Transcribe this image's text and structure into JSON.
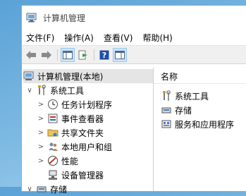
{
  "window": {
    "title": "计算机管理"
  },
  "menubar": {
    "items": [
      "文件(F)",
      "操作(A)",
      "查看(V)",
      "帮助(H)"
    ]
  },
  "tree": {
    "root": "计算机管理(本地)",
    "system_tools": "系统工具",
    "children": [
      "任务计划程序",
      "事件查看器",
      "共享文件夹",
      "本地用户和组",
      "性能",
      "设备管理器"
    ],
    "storage": "存储"
  },
  "right_pane": {
    "column_header": "名称",
    "items": [
      "系统工具",
      "存储",
      "服务和应用程序"
    ]
  },
  "colors": {
    "selection": "#e5e5e5",
    "toolbar_bg": "#f0f0f0",
    "desktop": "#7fbbe3"
  }
}
